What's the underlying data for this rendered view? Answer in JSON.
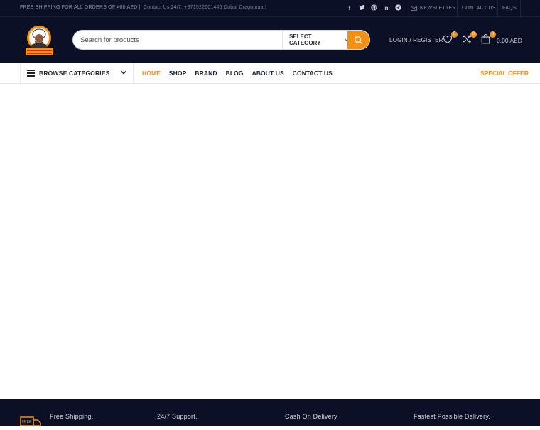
{
  "topbar": {
    "shipping_text": "FREE SHIPPING FOR ALL ORDERS OF 400 AED ||",
    "contact_text": "Contact Us 24/7: +971522601446 Dubai Dragonmart",
    "socials": [
      "facebook-icon",
      "twitter-icon",
      "pinterest-icon",
      "linkedin-icon",
      "telegram-icon"
    ],
    "newsletter": "NEWSLETTER",
    "contact_us": "CONTACT US",
    "faqs": "FAQS"
  },
  "header": {
    "search_placeholder": "Search for products",
    "category_label": "SELECT CATEGORY",
    "login_label": "LOGIN / REGISTER",
    "wishlist_count": "0",
    "compare_count": "0",
    "cart_count": "0",
    "cart_total": "0.00 AED"
  },
  "nav": {
    "browse_label": "BROWSE CATEGORIES",
    "items": [
      "HOME",
      "SHOP",
      "BRAND",
      "BLOG",
      "ABOUT US",
      "CONTACT US"
    ],
    "special_offer": "SPECIAL OFFER"
  },
  "footer": {
    "features": [
      "Free Shipping.",
      "24/7 Support.",
      "Cash On Delivery",
      "Fastest Possible Delivery."
    ]
  },
  "colors": {
    "dark_bg": "#0c1026",
    "accent": "#f39015"
  }
}
